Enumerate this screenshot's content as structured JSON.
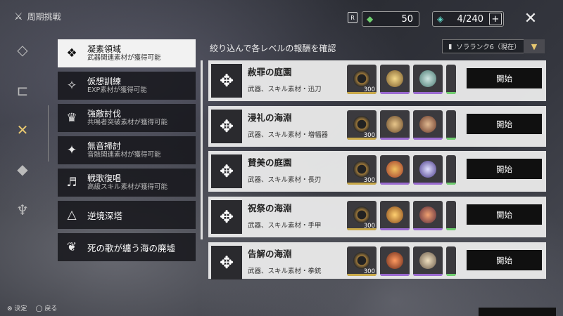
{
  "header": {
    "title": "周期挑戦",
    "resource_a": "50",
    "resource_b": "4/240",
    "plus": "+"
  },
  "rail": [
    "diamond-icon",
    "door-icon",
    "crossed-swords-icon",
    "mask-icon",
    "demon-icon"
  ],
  "categories": [
    {
      "title": "凝素領域",
      "sub": "武器関連素材が獲得可能",
      "selected": true
    },
    {
      "title": "仮想訓練",
      "sub": "EXP素材が獲得可能"
    },
    {
      "title": "強敵討伐",
      "sub": "共鳴者突破素材が獲得可能"
    },
    {
      "title": "無音掃討",
      "sub": "音骸関連素材が獲得可能"
    },
    {
      "title": "戦歌復唱",
      "sub": "高級スキル素材が獲得可能"
    },
    {
      "title": "逆境深塔"
    },
    {
      "title": "死の歌が纏う海の廃墟"
    }
  ],
  "panel": {
    "filter_label": "絞り込んで各レベルの報酬を確認",
    "rank": "ソラランク6（現在）",
    "start_label": "開始"
  },
  "rows": [
    {
      "name": "赦罪の庭園",
      "sub": "武器、スキル素材・迅刀",
      "qty": "300"
    },
    {
      "name": "浸礼の海淵",
      "sub": "武器、スキル素材・増幅器",
      "qty": "300"
    },
    {
      "name": "賛美の庭園",
      "sub": "武器、スキル素材・長刃",
      "qty": "300"
    },
    {
      "name": "祝祭の海淵",
      "sub": "武器、スキル素材・手甲",
      "qty": "300"
    },
    {
      "name": "告解の海淵",
      "sub": "武器、スキル素材・拳銃",
      "qty": "300"
    }
  ],
  "footer": {
    "confirm": "決定",
    "back": "戻る"
  },
  "colors": {
    "gold": "#c9a94a",
    "purple": "#9a6ad0",
    "green": "#6fcf6f"
  }
}
